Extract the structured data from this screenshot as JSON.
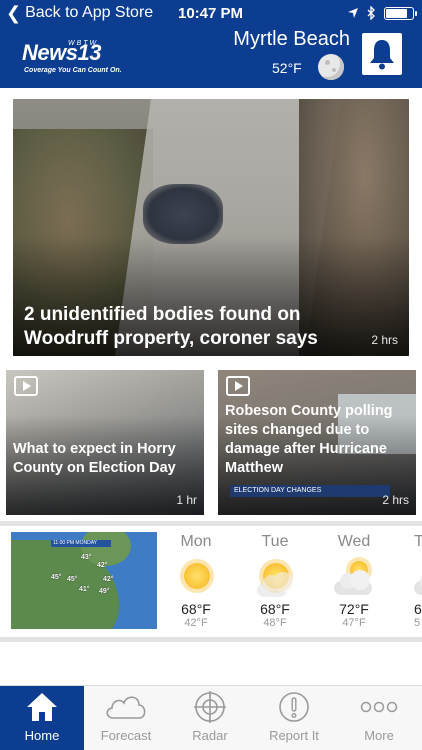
{
  "status_bar": {
    "back_label": "Back to App Store",
    "time": "10:47 PM",
    "battery_level": 0.85
  },
  "header": {
    "logo_text": "News",
    "logo_number": "13",
    "logo_call_sign": "WBTW",
    "logo_tagline": "Coverage You Can Count On.",
    "city": "Myrtle Beach",
    "temperature": "52°F",
    "bell_icon": "bell-icon",
    "brand_color": "#0c3d91"
  },
  "hero_story": {
    "title": "2 unidentified bodies found on Woodruff property, coroner says",
    "age": "2 hrs"
  },
  "stories": [
    {
      "title": "What to expect in Horry County on Election Day",
      "age": "1 hr",
      "icon": "play-icon"
    },
    {
      "title": "Robeson County polling sites changed due to damage after Hurricane Matthew",
      "age": "2 hrs",
      "icon": "play-icon",
      "banner": "ELECTION DAY CHANGES"
    }
  ],
  "weather": {
    "map": {
      "time_label": "11:00 PM MONDAY",
      "temps": [
        "43°",
        "42°",
        "45°",
        "42°",
        "41°",
        "45°",
        "49°"
      ]
    },
    "forecast": [
      {
        "day": "Mon",
        "high": "68°F",
        "low": "42°F",
        "icon": "sunny-icon"
      },
      {
        "day": "Tue",
        "high": "68°F",
        "low": "48°F",
        "icon": "sunny-icon"
      },
      {
        "day": "Wed",
        "high": "72°F",
        "low": "47°F",
        "icon": "partly-cloudy-icon"
      },
      {
        "day": "T",
        "high": "6",
        "low": "5",
        "icon": "partly-cloudy-icon"
      }
    ]
  },
  "tabs": [
    {
      "label": "Home",
      "icon": "home-icon",
      "active": true
    },
    {
      "label": "Forecast",
      "icon": "cloud-icon",
      "active": false
    },
    {
      "label": "Radar",
      "icon": "radar-icon",
      "active": false
    },
    {
      "label": "Report It",
      "icon": "alert-icon",
      "active": false
    },
    {
      "label": "More",
      "icon": "more-icon",
      "active": false
    }
  ]
}
